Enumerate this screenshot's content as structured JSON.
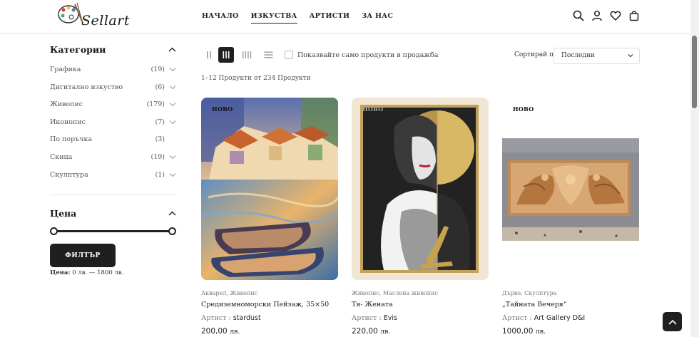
{
  "brand": {
    "logo_text": "Sellart"
  },
  "nav": [
    {
      "label": "НАЧАЛО",
      "active": false
    },
    {
      "label": "ИЗКУСТВА",
      "active": true
    },
    {
      "label": "АРТИСТИ",
      "active": false
    },
    {
      "label": "ЗА НАС",
      "active": false
    }
  ],
  "header_icons": [
    "search-icon",
    "user-icon",
    "heart-icon",
    "cart-icon"
  ],
  "sidebar": {
    "categories_title": "Категории",
    "categories": [
      {
        "label": "Графика",
        "count": "(19)",
        "expandable": true
      },
      {
        "label": "Дигитално изкуство",
        "count": "(6)",
        "expandable": true
      },
      {
        "label": "Живопис",
        "count": "(179)",
        "expandable": true
      },
      {
        "label": "Иконопис",
        "count": "(7)",
        "expandable": true
      },
      {
        "label": "По поръчка",
        "count": "(3)",
        "expandable": false
      },
      {
        "label": "Скица",
        "count": "(19)",
        "expandable": true
      },
      {
        "label": "Скулптура",
        "count": "(1)",
        "expandable": true
      }
    ],
    "price_title": "Цена",
    "price_slider": {
      "min_fraction": 0,
      "max_fraction": 1
    },
    "filter_button": "ФИЛТЪР",
    "price_label": "Цена:",
    "price_range": "0 лв. — 1800 лв."
  },
  "toolbar": {
    "onsale_label": "Показвайте само продукти в продажба",
    "sort_label": "Сортирай по",
    "sort_selected": "Последни"
  },
  "results_text": "1–12 Продукти от 234 Продукти",
  "products": [
    {
      "badge": "НОВО",
      "categories": "Акварел, Живопис",
      "name": "Средиземноморски Пейзаж, 35×50",
      "artist_label": "Артист :",
      "artist": "stardust",
      "price": "200,00",
      "currency": "лв."
    },
    {
      "badge": "НОВО",
      "categories": "Живопис, Маслена живопис",
      "name": "Тя- Жената",
      "artist_label": "Артист :",
      "artist": "Evis",
      "price": "220,00",
      "currency": "лв."
    },
    {
      "badge": "НОВО",
      "categories": "Дърво, Скулптура",
      "name": "„Тайната Вечеря“",
      "artist_label": "Артист :",
      "artist": "Art Gallery D&I",
      "price": "1000,00",
      "currency": "лв."
    }
  ],
  "colors": {
    "dark": "#1f1f1f",
    "text": "#222222",
    "muted": "#777777",
    "border": "#e6e6e6"
  }
}
